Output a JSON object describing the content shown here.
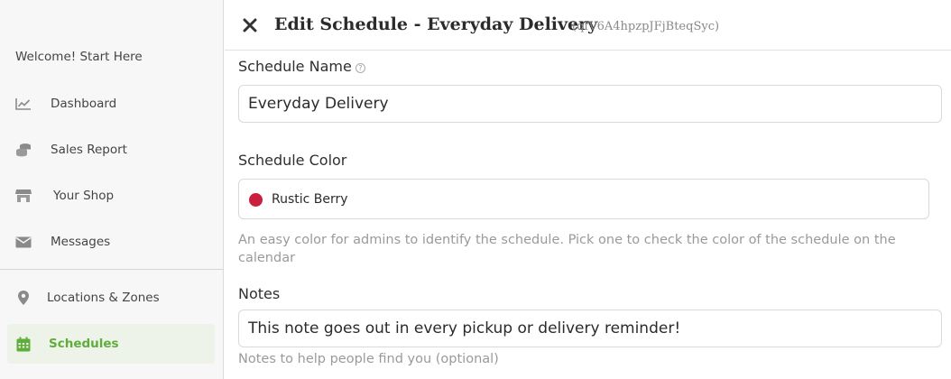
{
  "sidebar": {
    "welcome": "Welcome! Start Here",
    "items": [
      {
        "label": "Dashboard",
        "icon": "chart-line-icon"
      },
      {
        "label": "Sales Report",
        "icon": "coins-icon"
      },
      {
        "label": "Your Shop",
        "icon": "store-icon"
      },
      {
        "label": "Messages",
        "icon": "envelope-icon"
      },
      {
        "label": "Locations & Zones",
        "icon": "map-pin-icon"
      },
      {
        "label": "Schedules",
        "icon": "calendar-icon",
        "active": true
      }
    ],
    "active_color": "#5fae3c"
  },
  "header": {
    "title": "Edit Schedule - Everyday Delivery",
    "schedule_id": "(qfV6A4hpzpJFjBteqSyc)"
  },
  "form": {
    "name_label": "Schedule Name",
    "name_value": "Everyday Delivery",
    "color_label": "Schedule Color",
    "color_value": "Rustic Berry",
    "color_hex": "#c8203d",
    "color_hint": "An easy color for admins to identify the schedule. Pick one to check the color of the schedule on the calendar",
    "notes_label": "Notes",
    "notes_value": "This note goes out in every pickup or delivery reminder!",
    "notes_hint": "Notes to help people find you (optional)"
  }
}
